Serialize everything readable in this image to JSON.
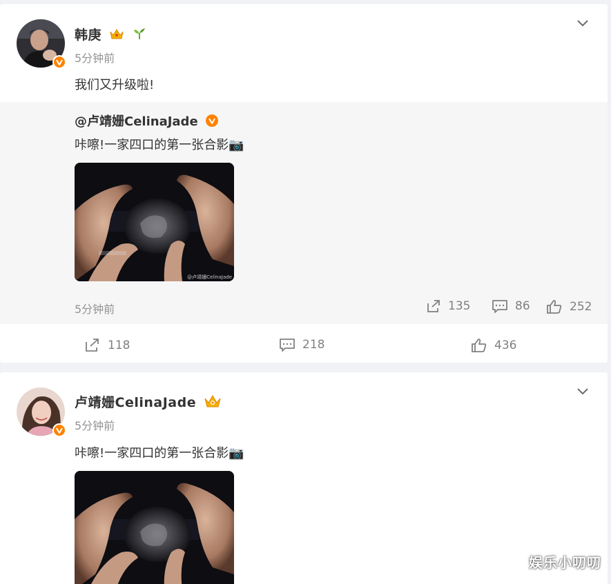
{
  "posts": [
    {
      "author": "韩庚",
      "time": "5分钟前",
      "text": "我们又升级啦!",
      "repost": {
        "author": "@卢靖姗CelinaJade",
        "text": "咔嚓!一家四口的第一张合影📷",
        "time": "5分钟前",
        "stats": {
          "reposts": "135",
          "comments": "86",
          "likes": "252"
        }
      },
      "stats": {
        "reposts": "118",
        "comments": "218",
        "likes": "436"
      }
    },
    {
      "author": "卢靖姗CelinaJade",
      "time": "5分钟前",
      "text": "咔嚓!一家四口的第一张合影📷"
    }
  ],
  "photo_watermark": "@卢靖姗CelinaJade",
  "watermark": "娱乐小叨叨",
  "colors": {
    "verified_badge": "#ff8200",
    "crown": "#f5b000",
    "muted_text": "#939393",
    "repost_bg": "#f6f6f6",
    "page_bg": "#f1f2f5"
  },
  "icons": [
    "verified-badge-icon",
    "crown-icon",
    "sprout-icon",
    "chevron-down-icon",
    "camera-emoji-icon",
    "repost-icon",
    "comment-icon",
    "like-icon"
  ]
}
